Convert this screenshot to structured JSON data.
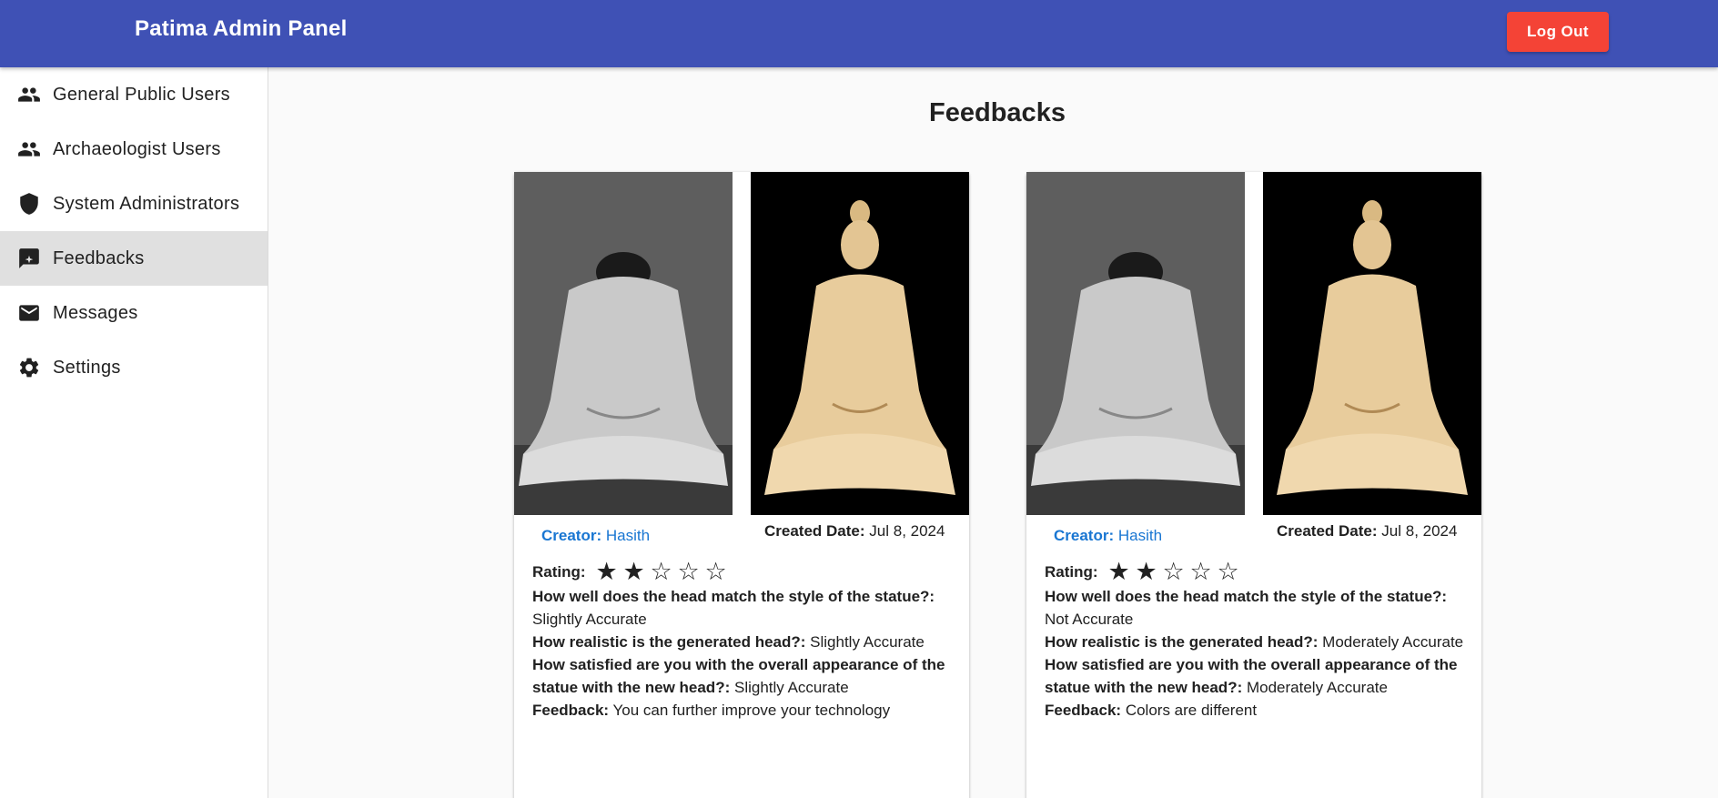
{
  "app": {
    "title": "Patima Admin Panel",
    "logout_label": "Log Out"
  },
  "sidebar": {
    "items": [
      {
        "label": "General Public Users",
        "icon": "people-icon"
      },
      {
        "label": "Archaeologist Users",
        "icon": "people-icon"
      },
      {
        "label": "System Administrators",
        "icon": "shield-icon"
      },
      {
        "label": "Feedbacks",
        "icon": "feedback-icon",
        "active": true
      },
      {
        "label": "Messages",
        "icon": "mail-icon"
      },
      {
        "label": "Settings",
        "icon": "gear-icon"
      }
    ]
  },
  "main": {
    "title": "Feedbacks",
    "labels": {
      "creator": "Creator:",
      "created_date": "Created Date:",
      "rating": "Rating:",
      "q1": "How well does the head match the style of the statue?:",
      "q2": "How realistic is the generated head?:",
      "q3": "How satisfied are you with the overall appearance of the statue with the new head?:",
      "feedback": "Feedback:"
    },
    "cards": [
      {
        "creator": "Hasith",
        "created_date": "Jul 8, 2024",
        "rating": 2,
        "max_rating": 5,
        "q1": "Slightly Accurate",
        "q2": "Slightly Accurate",
        "q3": "Slightly Accurate",
        "feedback": "You can further improve your technology"
      },
      {
        "creator": "Hasith",
        "created_date": "Jul 8, 2024",
        "rating": 2,
        "max_rating": 5,
        "q1": "Not Accurate",
        "q2": "Moderately Accurate",
        "q3": "Moderately Accurate",
        "feedback": "Colors are different"
      }
    ]
  },
  "colors": {
    "appbar": "#3f51b5",
    "logout": "#f44336",
    "creator": "#1976d2",
    "active_nav": "#e0e0e0"
  }
}
